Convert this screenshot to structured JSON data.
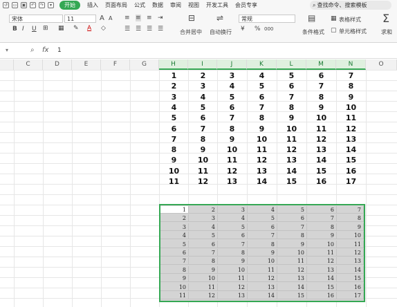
{
  "menu": {
    "tabs": [
      "开始",
      "插入",
      "页面布局",
      "公式",
      "数据",
      "审阅",
      "视图",
      "开发工具",
      "会员专享"
    ],
    "search_placeholder": "查找命令、搜索模板"
  },
  "ribbon": {
    "font_name": "宋体",
    "font_size": "11",
    "number_format": "常规",
    "merge_label": "合并居中",
    "wrap_label": "自动换行",
    "cond_format_label": "条件格式",
    "table_style_label": "表格样式",
    "cell_style_label": "单元格样式",
    "sum_label": "求和",
    "bold": "B",
    "italic": "I",
    "underline": "U",
    "grow": "A",
    "shrink": "A",
    "currency": "¥",
    "percent": "%",
    "thousands": "000"
  },
  "formula_bar": {
    "fx": "fx",
    "value": "1"
  },
  "columns": [
    "C",
    "D",
    "E",
    "F",
    "G",
    "H",
    "I",
    "J",
    "K",
    "L",
    "M",
    "N",
    "O"
  ],
  "top_table": [
    [
      "1",
      "2",
      "3",
      "4",
      "5",
      "6",
      "7"
    ],
    [
      "2",
      "3",
      "4",
      "5",
      "6",
      "7",
      "8"
    ],
    [
      "3",
      "4",
      "5",
      "6",
      "7",
      "8",
      "9"
    ],
    [
      "4",
      "5",
      "6",
      "7",
      "8",
      "9",
      "10"
    ],
    [
      "5",
      "6",
      "7",
      "8",
      "9",
      "10",
      "11"
    ],
    [
      "6",
      "7",
      "8",
      "9",
      "10",
      "11",
      "12"
    ],
    [
      "7",
      "8",
      "9",
      "10",
      "11",
      "12",
      "13"
    ],
    [
      "8",
      "9",
      "10",
      "11",
      "12",
      "13",
      "14"
    ],
    [
      "9",
      "10",
      "11",
      "12",
      "13",
      "14",
      "15"
    ],
    [
      "10",
      "11",
      "12",
      "13",
      "14",
      "15",
      "16"
    ],
    [
      "11",
      "12",
      "13",
      "14",
      "15",
      "16",
      "17"
    ]
  ],
  "bottom_table": [
    [
      "1",
      "2",
      "3",
      "4",
      "5",
      "6",
      "7"
    ],
    [
      "2",
      "3",
      "4",
      "5",
      "6",
      "7",
      "8"
    ],
    [
      "3",
      "4",
      "5",
      "6",
      "7",
      "8",
      "9"
    ],
    [
      "4",
      "5",
      "6",
      "7",
      "8",
      "9",
      "10"
    ],
    [
      "5",
      "6",
      "7",
      "8",
      "9",
      "10",
      "11"
    ],
    [
      "6",
      "7",
      "8",
      "9",
      "10",
      "11",
      "12"
    ],
    [
      "7",
      "8",
      "9",
      "10",
      "11",
      "12",
      "13"
    ],
    [
      "8",
      "9",
      "10",
      "11",
      "12",
      "13",
      "14"
    ],
    [
      "9",
      "10",
      "11",
      "12",
      "13",
      "14",
      "15"
    ],
    [
      "10",
      "11",
      "12",
      "13",
      "14",
      "15",
      "16"
    ],
    [
      "11",
      "12",
      "13",
      "14",
      "15",
      "16",
      "17"
    ]
  ],
  "accent_color": "#35a854"
}
